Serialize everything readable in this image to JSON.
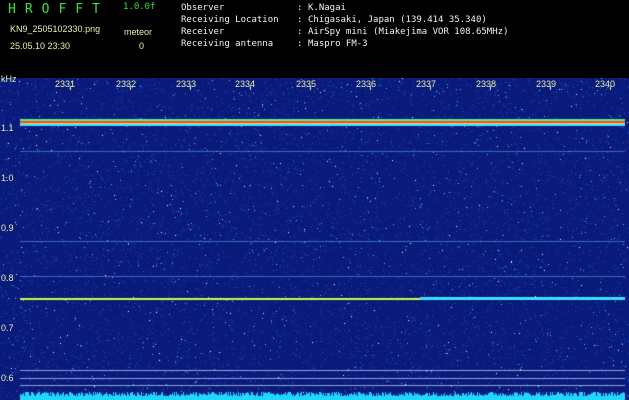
{
  "header": {
    "app_title": "HROFFT",
    "version": "1.0.0f",
    "filename": "KN9_2505102330.png",
    "datetime": "25.05.10 23:30",
    "meteor_label": "meteor",
    "meteor_count": "0"
  },
  "info": [
    {
      "label": "Observer",
      "value": "K.Nagai"
    },
    {
      "label": "Receiving Location",
      "value": "Chigasaki, Japan (139.414 35.340)"
    },
    {
      "label": "Receiver",
      "value": "AirSpy mini (Miakejima VOR 108.65MHz)"
    },
    {
      "label": "Receiving antenna",
      "value": "Maspro FM-3"
    }
  ],
  "info_colon": ":",
  "axis": {
    "unit": "kHz",
    "y_labels": [
      "1.1",
      "1.0",
      "0.9",
      "0.8",
      "0.7",
      "0.6"
    ],
    "x_labels": [
      "2331",
      "2332",
      "2333",
      "2334",
      "2335",
      "2336",
      "2337",
      "2338",
      "2339",
      "2340"
    ]
  },
  "colors": {
    "background": "#000000",
    "spectrogram_bg": "#0a1a7a",
    "title_green": "#37e23a",
    "label_yellow": "#e8f0a8",
    "carrier_line": "#ff4040",
    "meteor_trace": "#c8ff40",
    "noise_floor": "#20d8ff"
  }
}
